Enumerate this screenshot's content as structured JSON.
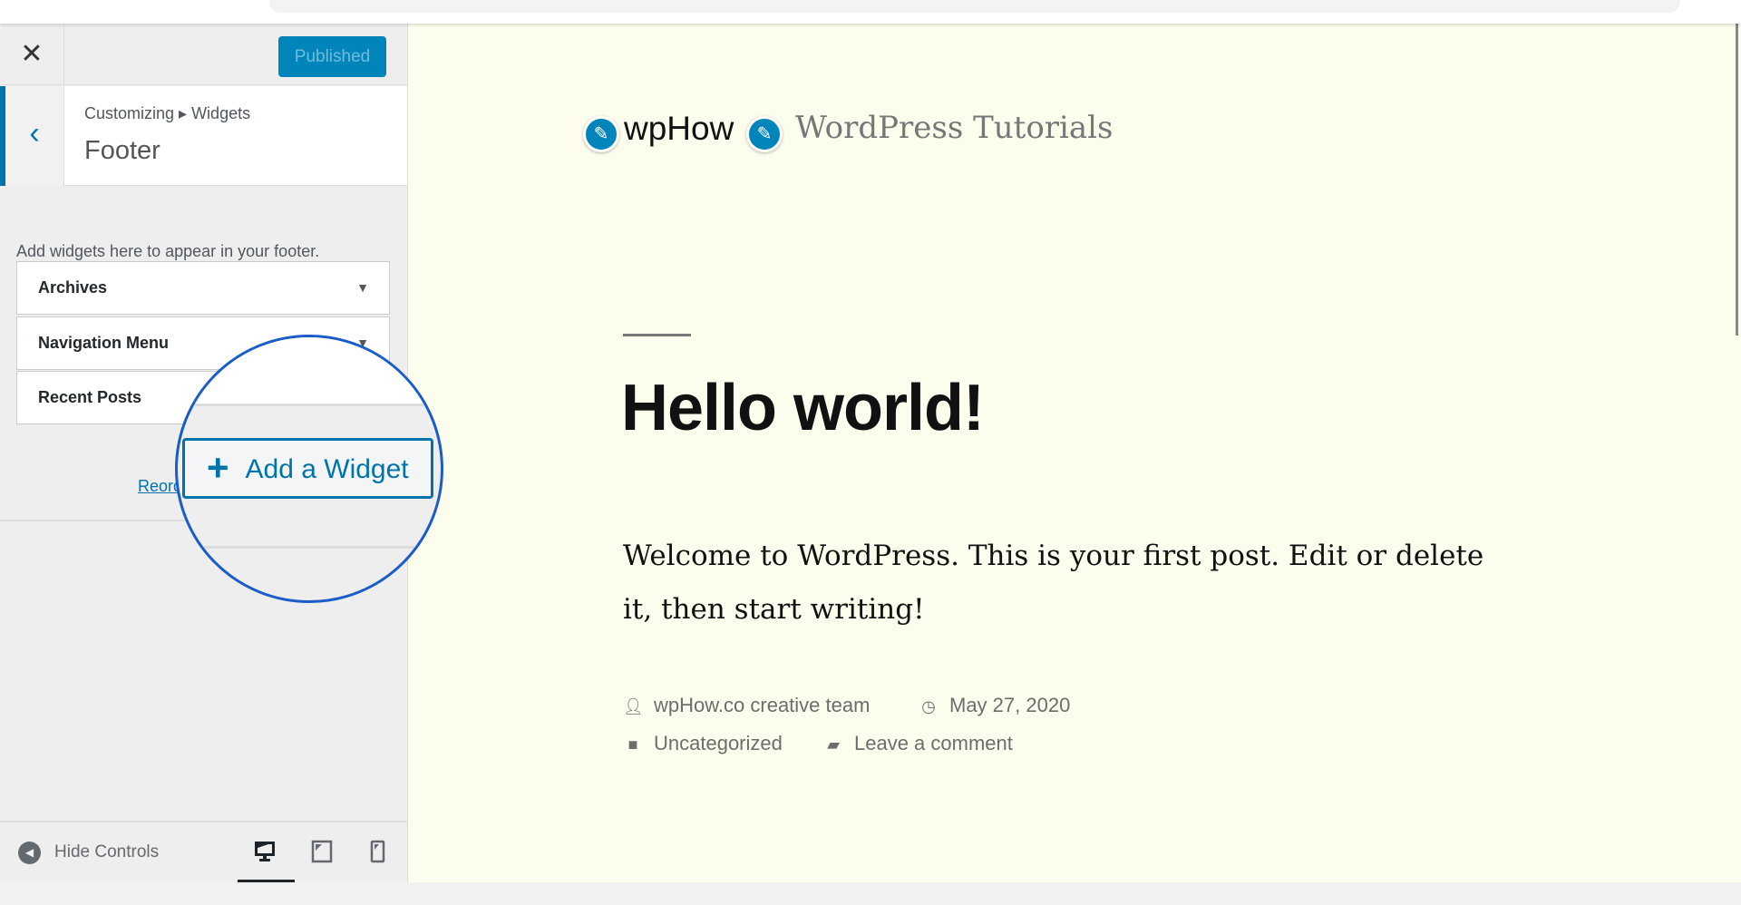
{
  "customizer": {
    "close_label": "✕",
    "publish_label": "Published",
    "back_label": "‹",
    "breadcrumb": "Customizing ▸ Widgets",
    "section_title": "Footer",
    "description": "Add widgets here to appear in your footer.",
    "widgets": [
      {
        "title": "Archives"
      },
      {
        "title": "Navigation Menu"
      },
      {
        "title": "Recent Posts"
      }
    ],
    "reorder_label": "Reorder",
    "add_widget_label": "Add a Widget",
    "hide_controls_label": "Hide Controls",
    "devices": [
      "desktop",
      "tablet",
      "mobile"
    ],
    "active_device": "desktop",
    "accent_color": "#0073aa"
  },
  "preview": {
    "site_title": "wpHow",
    "site_description": "WordPress Tutorials",
    "post_title": "Hello world!",
    "post_body": "Welcome to WordPress. This is your first post. Edit or delete it, then start writing!",
    "author": "wpHow.co creative team",
    "date": "May 27, 2020",
    "category": "Uncategorized",
    "comment_link": "Leave a comment",
    "background_color": "#fdfdee"
  }
}
